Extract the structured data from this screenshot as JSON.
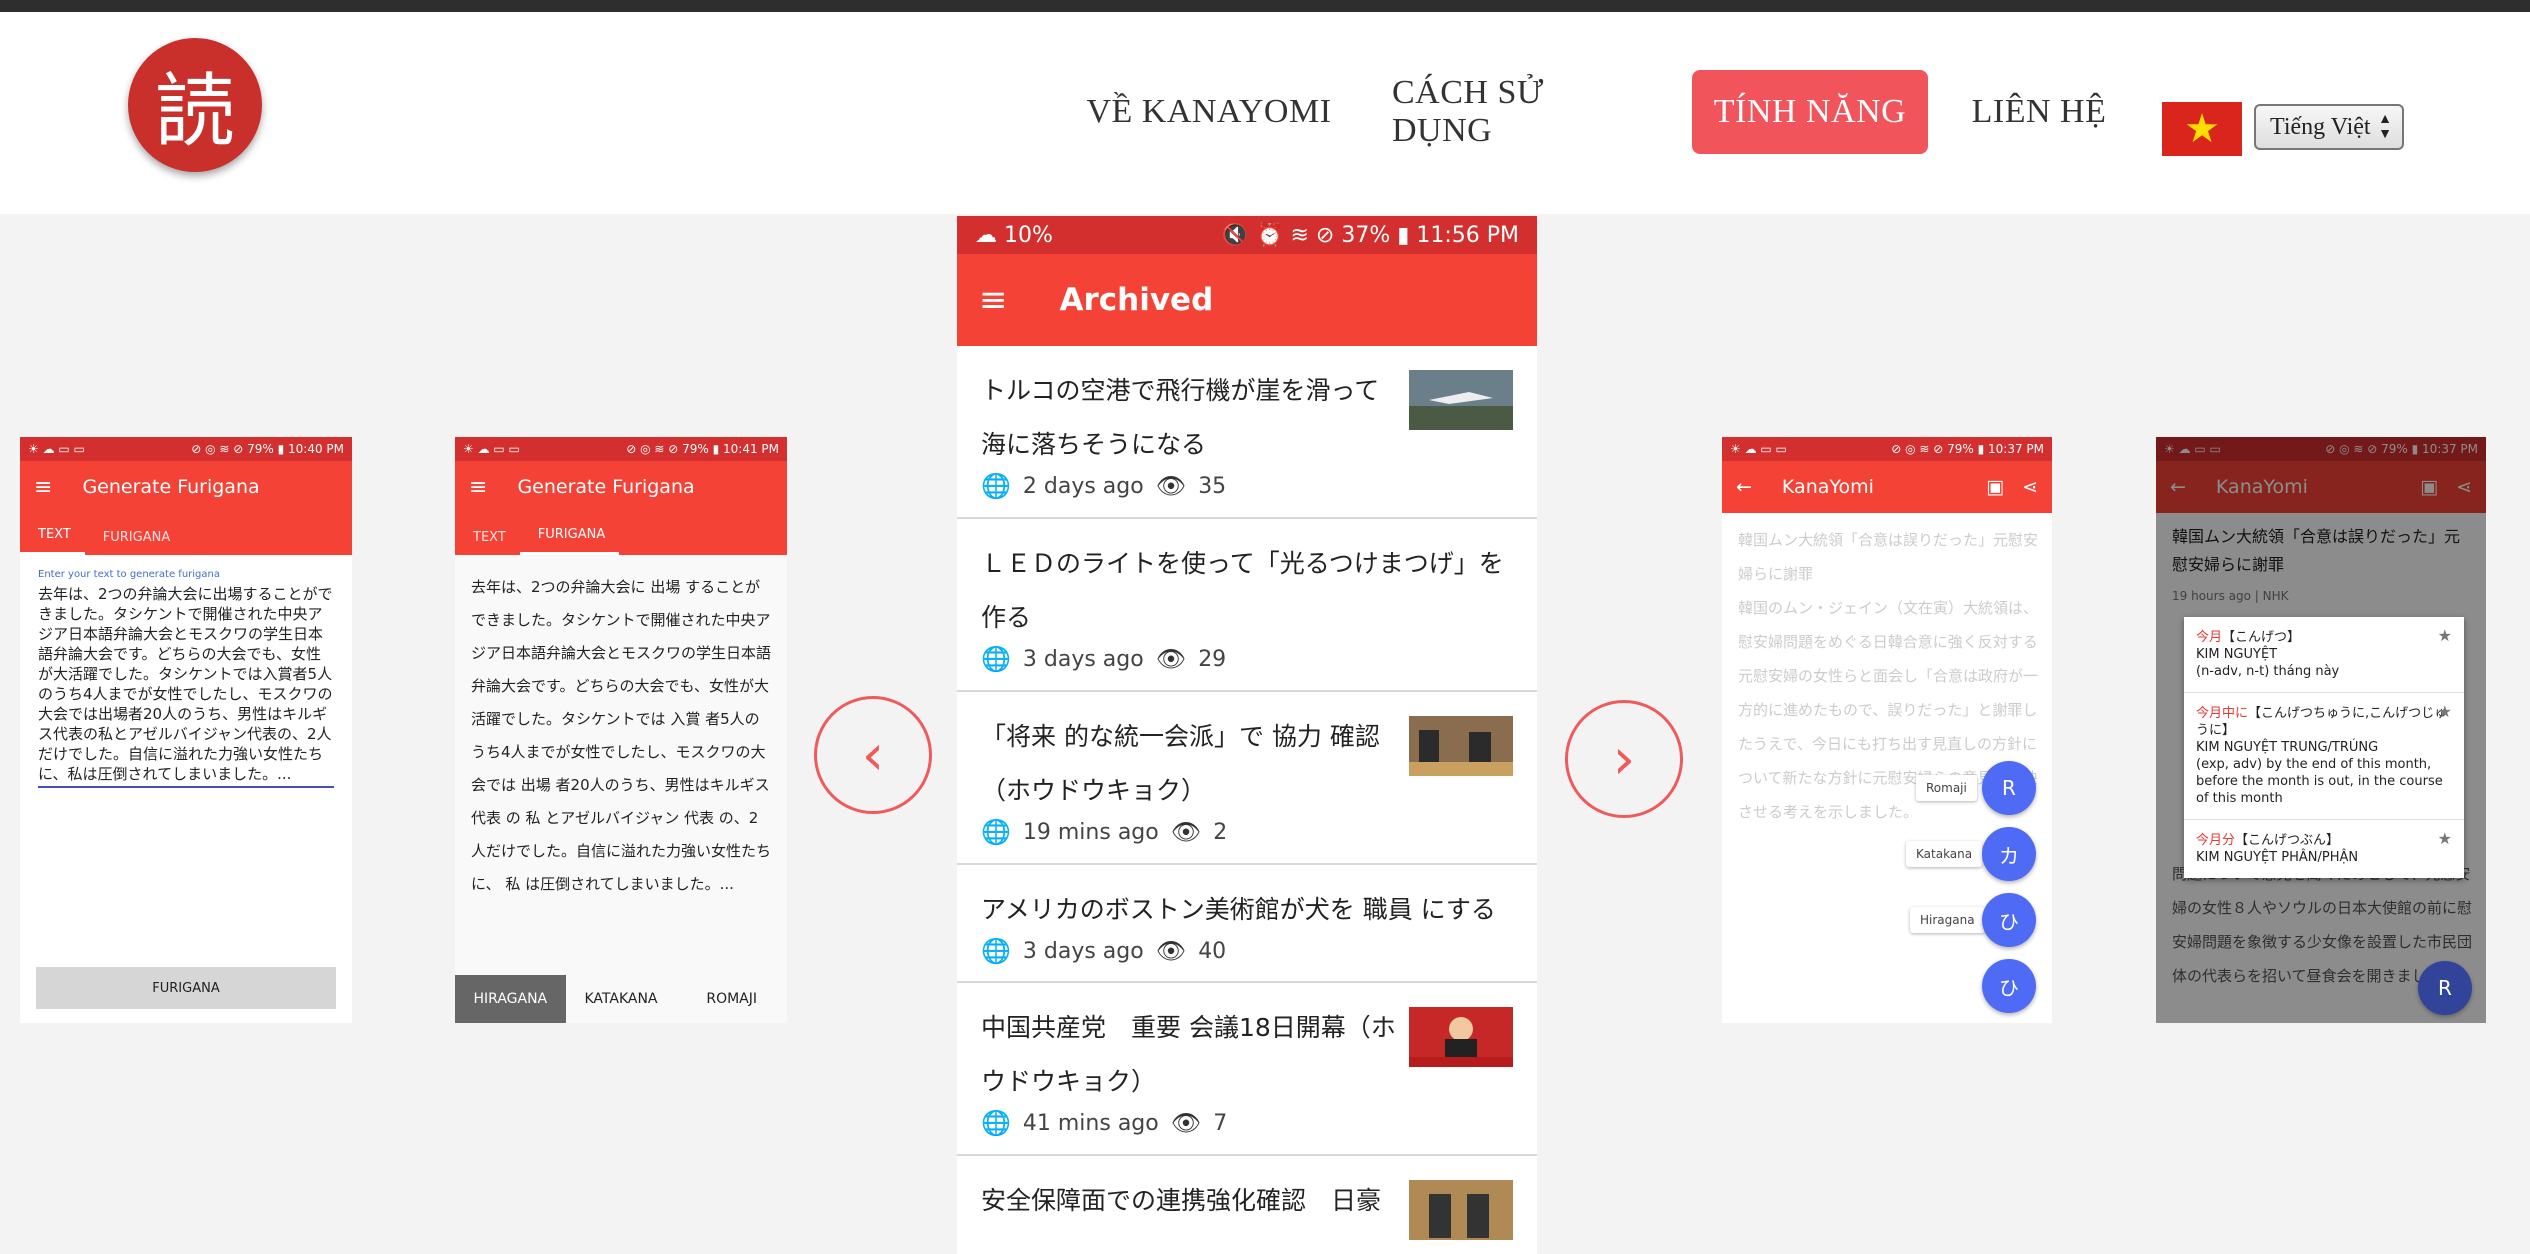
{
  "header": {
    "logo_char": "読",
    "nav": [
      {
        "label": "VỀ KANAYOMI"
      },
      {
        "label": "CÁCH SỬ DỤNG"
      },
      {
        "label": "TÍNH NĂNG"
      },
      {
        "label": "LIÊN HỆ"
      }
    ],
    "flag_star": "★",
    "language_select": "Tiếng Việt"
  },
  "phone1": {
    "status_left": "☀ ☁ ▭ ▭",
    "status_right": "⊘ ◎ ≋ ⊘ 79% ▮ 10:40 PM",
    "title": "Generate Furigana",
    "tabs": [
      "TEXT",
      "FURIGANA"
    ],
    "hint": "Enter your text to generate furigana",
    "text": "去年は、2つの弁論大会に出場することができました。タシケントで開催された中央アジア日本語弁論大会とモスクワの学生日本語弁論大会です。どちらの大会でも、女性が大活躍でした。タシケントでは入賞者5人のうち4人までが女性でしたし、モスクワの大会では出場者20人のうち、男性はキルギス代表の私とアゼルバイジャン代表の、2人だけでした。自信に溢れた力強い女性たちに、私は圧倒されてしまいました。...",
    "button": "FURIGANA"
  },
  "phone2": {
    "status_left": "☀ ☁ ▭ ▭",
    "status_right": "⊘ ◎ ≋ ⊘ 79% ▮ 10:41 PM",
    "title": "Generate Furigana",
    "tabs": [
      "TEXT",
      "FURIGANA"
    ],
    "text": "去年は、2つの弁論大会に 出場 することができました。タシケントで開催された中央アジア日本語弁論大会とモスクワの学生日本語弁論大会です。どちらの大会でも、女性が大活躍でした。タシケントでは 入賞 者5人のうち4人までが女性でしたし、モスクワの大会では 出場 者20人のうち、男性はキルギス 代表 の 私 とアゼルバイジャン 代表 の、2人だけでした。自信に溢れた力強い女性たちに、 私 は圧倒されてしまいました。...",
    "bottom_tabs": [
      "HIRAGANA",
      "KATAKANA",
      "ROMAJI"
    ]
  },
  "phone3": {
    "status_left": "☁ 10%",
    "status_right": "🔇 ⏰ ≋ ⊘ 37% ▮ 11:56 PM",
    "title": "Archived",
    "articles": [
      {
        "title": "トルコの空港で飛行機が崖を滑って海に落ちそうになる",
        "time": "2 days ago",
        "views": "35"
      },
      {
        "title": "ＬＥＤのライトを使って「光るつけまつげ」を作る",
        "time": "3 days ago",
        "views": "29"
      },
      {
        "title": "「将来 的な統一会派」で 協力 確認（ホウドウキョク）",
        "time": "19 mins ago",
        "views": "2"
      },
      {
        "title": "アメリカのボストン美術館が犬を 職員 にする",
        "time": "3 days ago",
        "views": "40"
      },
      {
        "title": "中国共産党　重要 会議18日開幕（ホウドウキョク）",
        "time": "41 mins ago",
        "views": "7"
      },
      {
        "title": "安全保障面での連携強化確認　日豪",
        "time": "",
        "views": ""
      }
    ]
  },
  "phone4": {
    "status_left": "☀ ☁ ▭ ▭",
    "status_right": "⊘ ◎ ≋ ⊘ 79% ▮ 10:37 PM",
    "title": "KanaYomi",
    "fab_labels": [
      "Romaji",
      "Katakana",
      "Hiragana"
    ],
    "fab_chars": [
      "R",
      "カ",
      "ひ",
      "ひ"
    ]
  },
  "phone5": {
    "status_left": "☀ ☁ ▭ ▭",
    "status_right": "⊘ ◎ ≋ ⊘ 79% ▮ 10:37 PM",
    "title": "KanaYomi",
    "headline": "韓国ムン大統領「合意は誤りだった」元慰安婦らに謝罪",
    "source": "19 hours ago | NHK",
    "dict": [
      {
        "word": "今月",
        "reading": "【こんげつ】",
        "hv": "KIM NGUYỆT",
        "meaning": "(n-adv, n-t) tháng này"
      },
      {
        "word": "今月中に",
        "reading": "【こんげつちゅうに,こんげつじゅうに】",
        "hv": "KIM NGUYỆT TRUNG/TRÚNG",
        "meaning": "(exp, adv) by the end of this month, before the month is out, in the course of this month"
      },
      {
        "word": "今月分",
        "reading": "【こんげつぶん】",
        "hv": "KIM NGUYỆT PHÂN/PHẬN",
        "meaning": ""
      }
    ],
    "fab": "R"
  }
}
